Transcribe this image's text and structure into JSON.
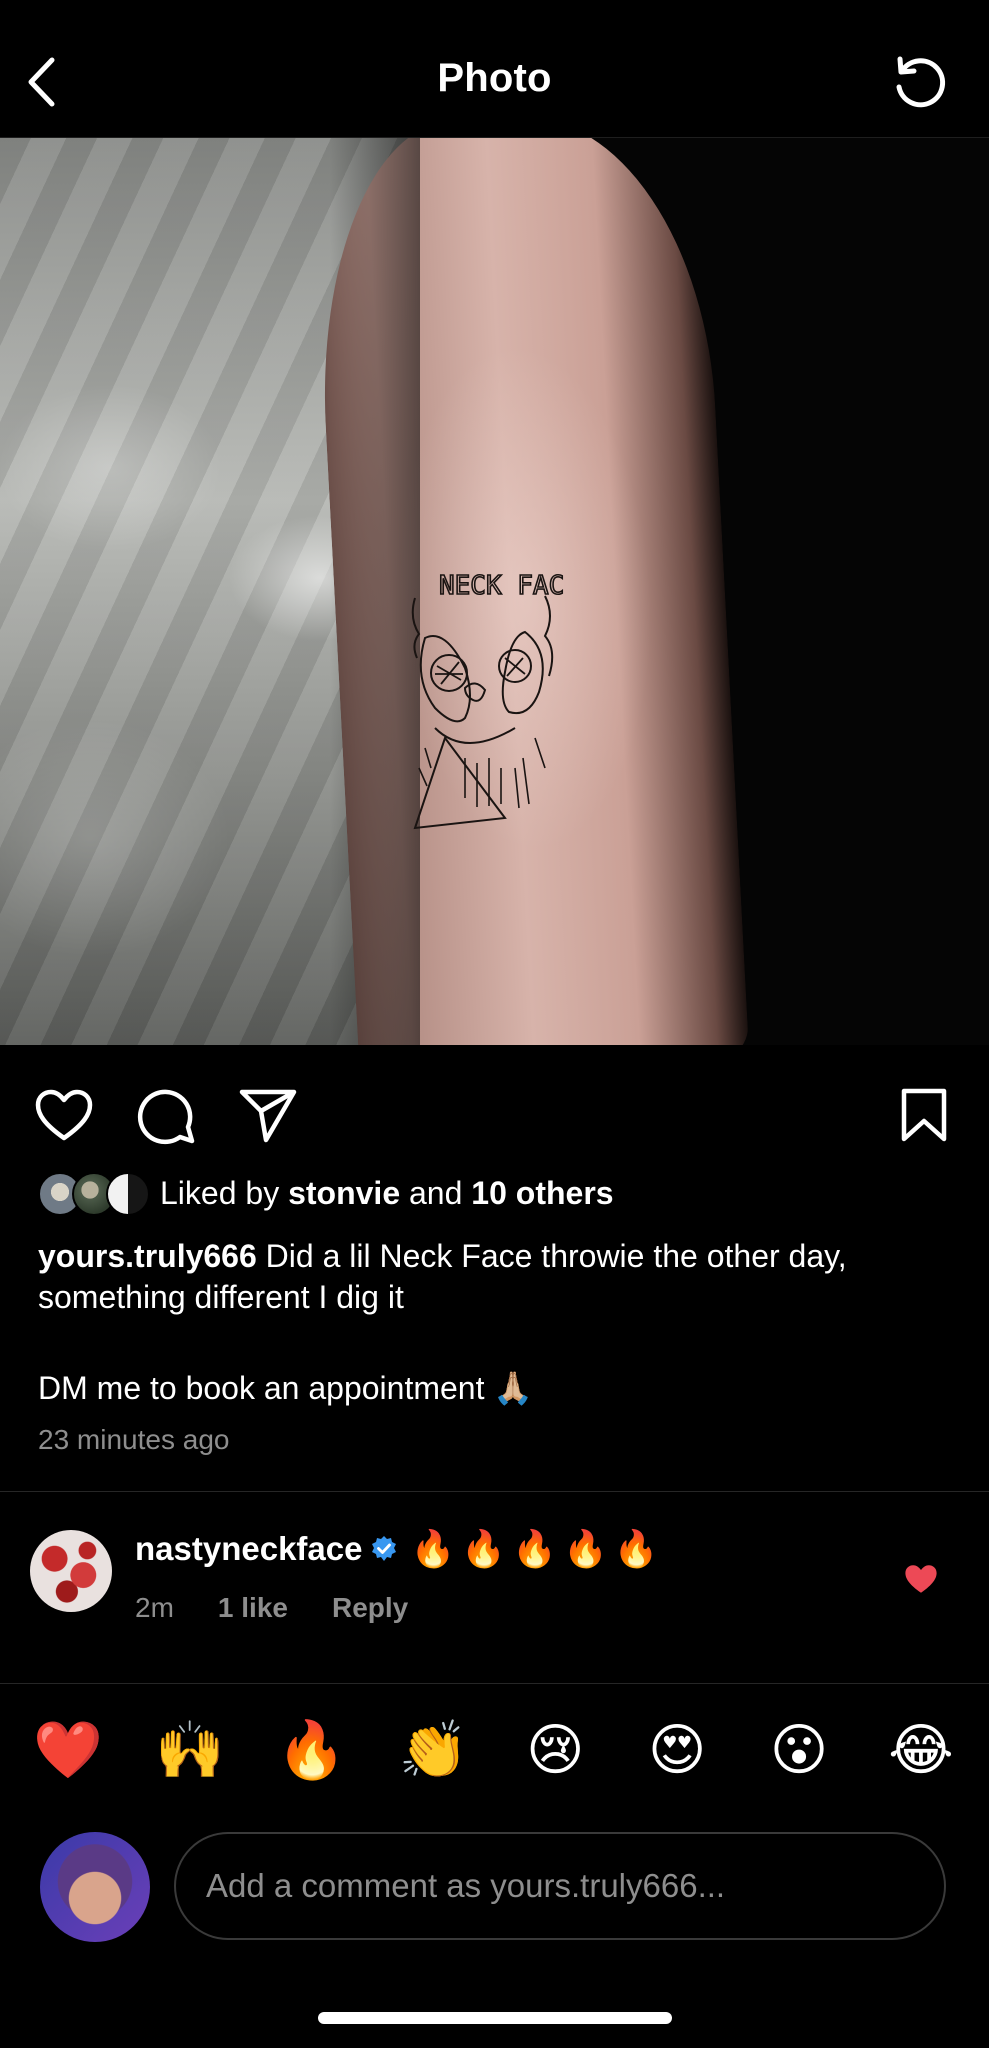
{
  "header": {
    "title": "Photo",
    "back_icon": "chevron-left-icon",
    "refresh_icon": "refresh-icon"
  },
  "post": {
    "image_alt": "Forearm with a black line-drawing tattoo of a face with NECK FACE lettering",
    "tattoo_text": "NECK FACE",
    "actions": {
      "like_icon": "heart-outline-icon",
      "comment_icon": "comment-icon",
      "share_icon": "paper-plane-icon",
      "save_icon": "bookmark-icon"
    },
    "likes": {
      "prefix": "Liked by",
      "user": "stonvie",
      "and": "and",
      "others": "10 others"
    },
    "caption": {
      "username": "yours.truly666",
      "text": "Did a lil Neck Face throwie the other day, something different I dig it",
      "line2": "DM me to book an appointment 🙏🏼"
    },
    "timestamp": "23 minutes ago"
  },
  "comment": {
    "username": "nastyneckface",
    "verified": true,
    "text": "🔥🔥🔥🔥🔥",
    "age": "2m",
    "likes": "1 like",
    "reply": "Reply",
    "liked": true,
    "like_color": "#ed4956"
  },
  "reactions": [
    "❤️",
    "🙌",
    "🔥",
    "👏",
    "😢",
    "😍",
    "😮",
    "😂"
  ],
  "composer": {
    "placeholder": "Add a comment as yours.truly666..."
  },
  "colors": {
    "background": "#000000",
    "secondary_text": "#8e8e8e",
    "verified_blue": "#3897f0"
  }
}
